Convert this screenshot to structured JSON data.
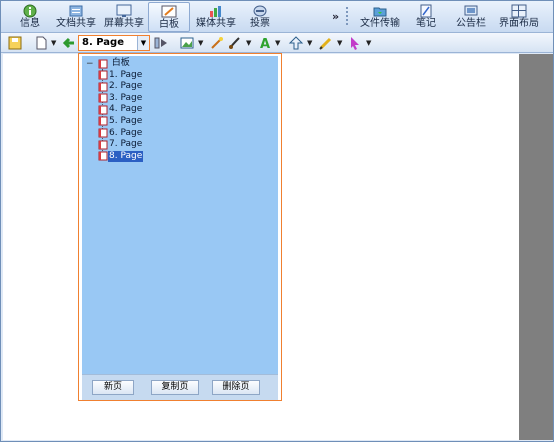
{
  "topbar": {
    "tools": [
      {
        "label": "信息",
        "icon": "info-icon"
      },
      {
        "label": "文档共享",
        "icon": "document-share-icon"
      },
      {
        "label": "屏幕共享",
        "icon": "screen-share-icon"
      },
      {
        "label": "白板",
        "icon": "whiteboard-icon",
        "active": true
      },
      {
        "label": "媒体共享",
        "icon": "media-share-icon"
      },
      {
        "label": "投票",
        "icon": "vote-icon"
      },
      {
        "label": "文件传输",
        "icon": "file-transfer-icon"
      },
      {
        "label": "笔记",
        "icon": "notes-icon"
      },
      {
        "label": "公告栏",
        "icon": "bulletin-icon"
      },
      {
        "label": "界面布局",
        "icon": "layout-icon"
      }
    ],
    "more": "»"
  },
  "toolbar2": {
    "page_select": "8. Page"
  },
  "tree": {
    "root": "白板",
    "expander": "−",
    "pages": [
      "1. Page",
      "2. Page",
      "3. Page",
      "4. Page",
      "5. Page",
      "6. Page",
      "7. Page",
      "8. Page"
    ],
    "selected_index": 7
  },
  "panel_buttons": {
    "new": "新页",
    "copy": "复制页",
    "delete": "删除页"
  },
  "colors": {
    "accent_border": "#f08030",
    "panel_bg": "#99c8f4",
    "selection": "#2b5fc3"
  }
}
